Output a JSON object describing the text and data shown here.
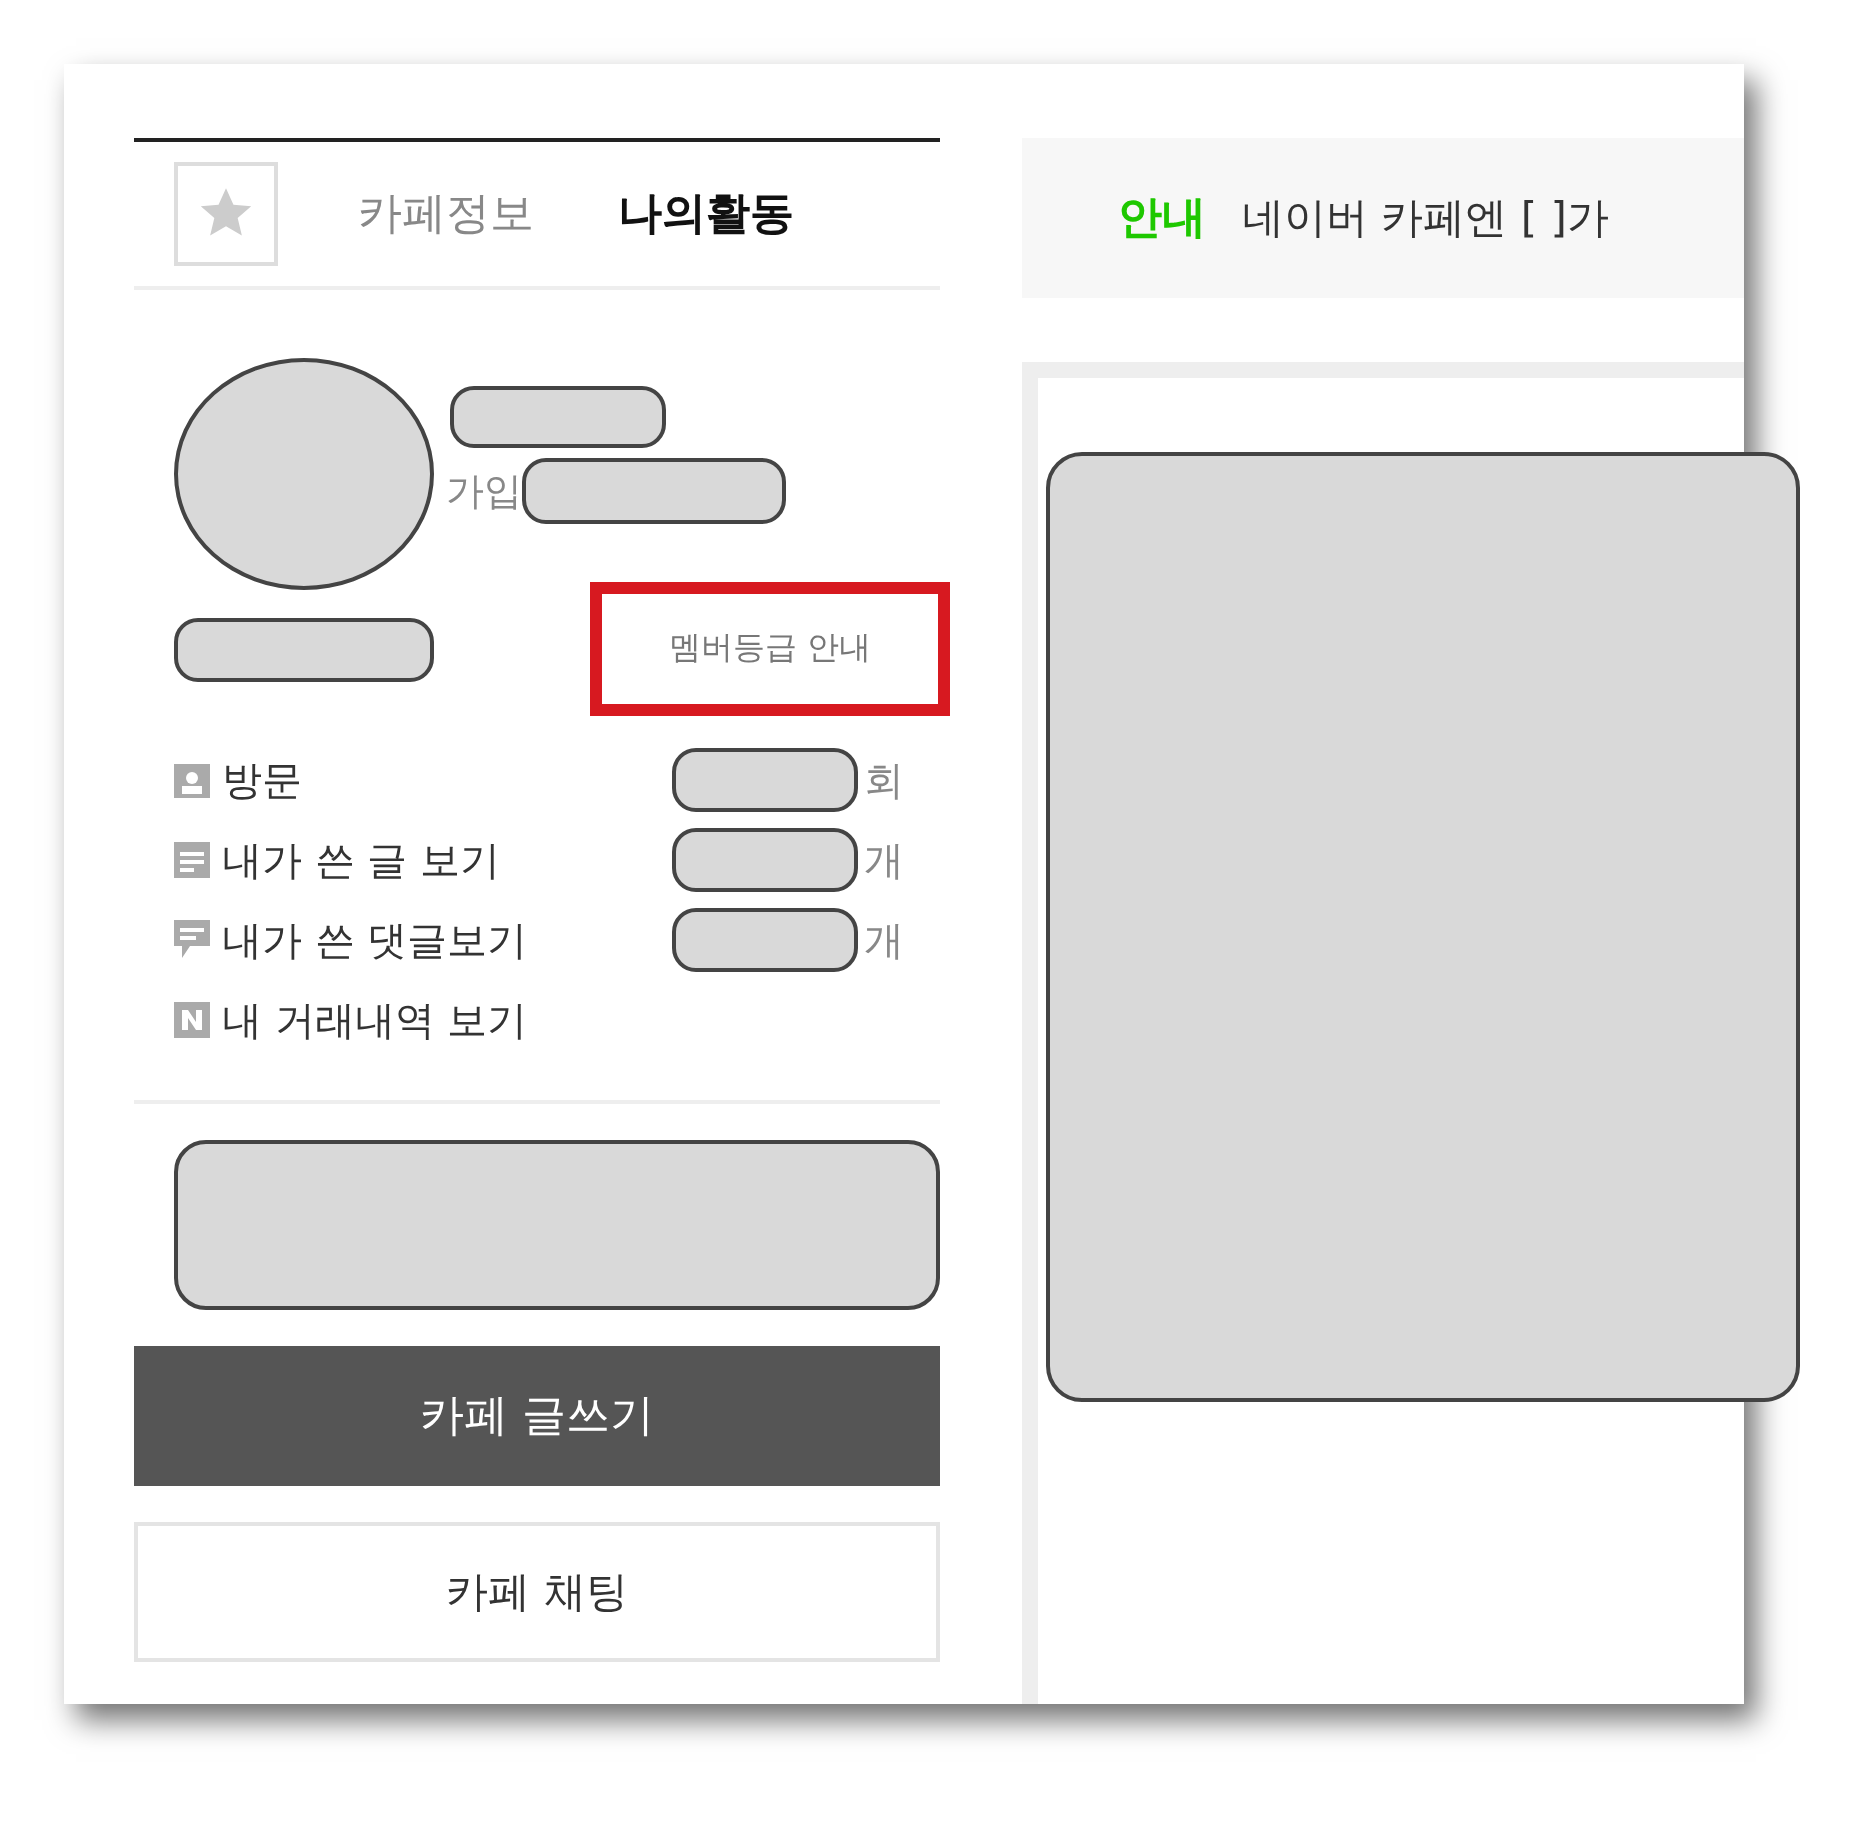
{
  "tabs": [
    {
      "label": "카페정보",
      "selected": false
    },
    {
      "label": "나의활동",
      "selected": true
    }
  ],
  "profile": {
    "join_label": "가입",
    "grade_link": "멤버등급 안내"
  },
  "stats": [
    {
      "kind": "visits",
      "label": "방문",
      "unit": "회"
    },
    {
      "kind": "posts",
      "label": "내가 쓴 글 보기",
      "unit": "개"
    },
    {
      "kind": "comments",
      "label": "내가 쓴 댓글보기",
      "unit": "개"
    },
    {
      "kind": "trades",
      "label": "내 거래내역 보기"
    }
  ],
  "buttons": {
    "write": "카페 글쓰기",
    "chat": "카페 채팅"
  },
  "notice": {
    "tag": "안내",
    "text": "네이버 카페엔 [ ]가"
  }
}
